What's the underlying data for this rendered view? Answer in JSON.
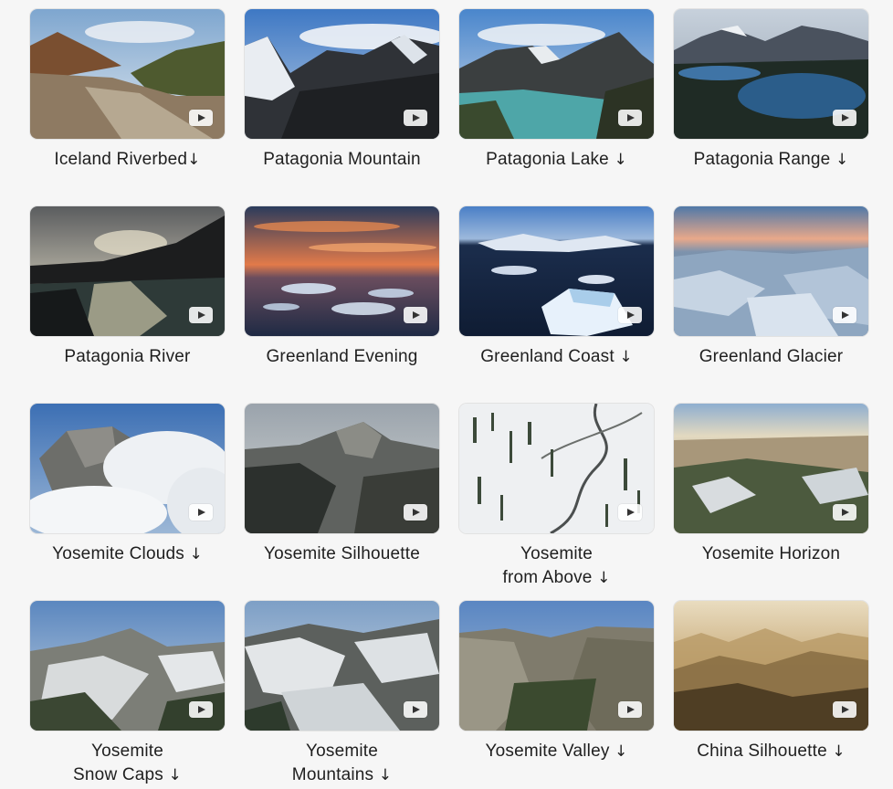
{
  "download_glyph": "↓",
  "items": [
    {
      "title": "Iceland Riverbed",
      "download": true
    },
    {
      "title": "Patagonia Mountain",
      "download": false
    },
    {
      "title": "Patagonia Lake",
      "download": true
    },
    {
      "title": "Patagonia Range",
      "download": true
    },
    {
      "title": "Patagonia River",
      "download": false
    },
    {
      "title": "Greenland Evening",
      "download": false
    },
    {
      "title": "Greenland Coast",
      "download": true
    },
    {
      "title": "Greenland Glacier",
      "download": false
    },
    {
      "title": "Yosemite Clouds",
      "download": true
    },
    {
      "title": "Yosemite Silhouette",
      "download": false
    },
    {
      "title": "Yosemite\nfrom Above",
      "download": true
    },
    {
      "title": "Yosemite Horizon",
      "download": false
    },
    {
      "title": "Yosemite\nSnow Caps",
      "download": true
    },
    {
      "title": "Yosemite\nMountains",
      "download": true
    },
    {
      "title": "Yosemite Valley",
      "download": true
    },
    {
      "title": "China Silhouette",
      "download": true
    }
  ]
}
